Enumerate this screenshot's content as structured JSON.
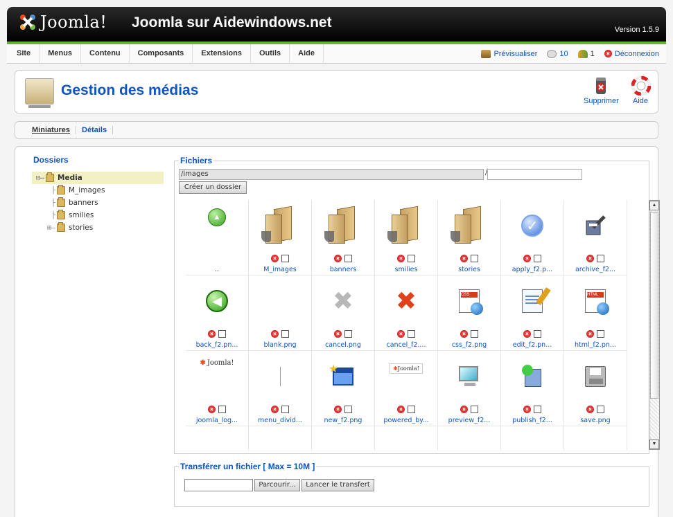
{
  "header": {
    "logo_text": "Joomla!",
    "site_name": "Joomla sur Aidewindows.net",
    "version": "Version 1.5.9"
  },
  "menu": {
    "items": [
      "Site",
      "Menus",
      "Contenu",
      "Composants",
      "Extensions",
      "Outils",
      "Aide"
    ],
    "preview": "Prévisualiser",
    "messages": "10",
    "users": "1",
    "logout": "Déconnexion"
  },
  "toolbar": {
    "title": "Gestion des médias",
    "delete_label": "Supprimer",
    "help_label": "Aide"
  },
  "tabs": [
    "Miniatures",
    "Détails"
  ],
  "folders": {
    "title": "Dossiers",
    "tree": [
      {
        "label": "Media",
        "lines": "⊟–",
        "root": true
      },
      {
        "label": "M_images",
        "lines": "├"
      },
      {
        "label": "banners",
        "lines": "├"
      },
      {
        "label": "smilies",
        "lines": "├"
      },
      {
        "label": "stories",
        "lines": "⊞–"
      }
    ]
  },
  "files": {
    "legend": "Fichiers",
    "path": "/images",
    "slash": "/",
    "new_folder_value": "",
    "create_button": "Créer un dossier",
    "items": [
      {
        "name": "..",
        "icon": "up-arrow-icon",
        "controls": false
      },
      {
        "name": "M_images",
        "icon": "folder-icon"
      },
      {
        "name": "banners",
        "icon": "folder-icon"
      },
      {
        "name": "smilies",
        "icon": "folder-icon"
      },
      {
        "name": "stories",
        "icon": "folder-icon"
      },
      {
        "name": "apply_f2.p...",
        "icon": "checkmark-icon"
      },
      {
        "name": "archive_f2...",
        "icon": "archive-icon"
      },
      {
        "name": "back_f2.pn...",
        "icon": "back-arrow-icon"
      },
      {
        "name": "blank.png",
        "icon": "blank-icon"
      },
      {
        "name": "cancel.png",
        "icon": "cancel-grey-icon"
      },
      {
        "name": "cancel_f2....",
        "icon": "cancel-red-icon"
      },
      {
        "name": "css_f2.png",
        "icon": "css-icon"
      },
      {
        "name": "edit_f2.pn...",
        "icon": "edit-icon"
      },
      {
        "name": "html_f2.pn...",
        "icon": "html-icon"
      },
      {
        "name": "joomla_log...",
        "icon": "joomla-logo-icon"
      },
      {
        "name": "menu_divid...",
        "icon": "divider-icon"
      },
      {
        "name": "new_f2.png",
        "icon": "new-window-icon"
      },
      {
        "name": "powered_by...",
        "icon": "powered-by-icon"
      },
      {
        "name": "preview_f2...",
        "icon": "monitor-icon"
      },
      {
        "name": "publish_f2...",
        "icon": "publish-icon"
      },
      {
        "name": "save.png",
        "icon": "save-icon"
      }
    ]
  },
  "upload": {
    "legend": "Transférer un fichier [ Max = 10M ]",
    "browse": "Parcourir...",
    "start": "Lancer le transfert"
  },
  "colors": {
    "accent": "#0b55c4",
    "header_green": "#5fb634"
  }
}
